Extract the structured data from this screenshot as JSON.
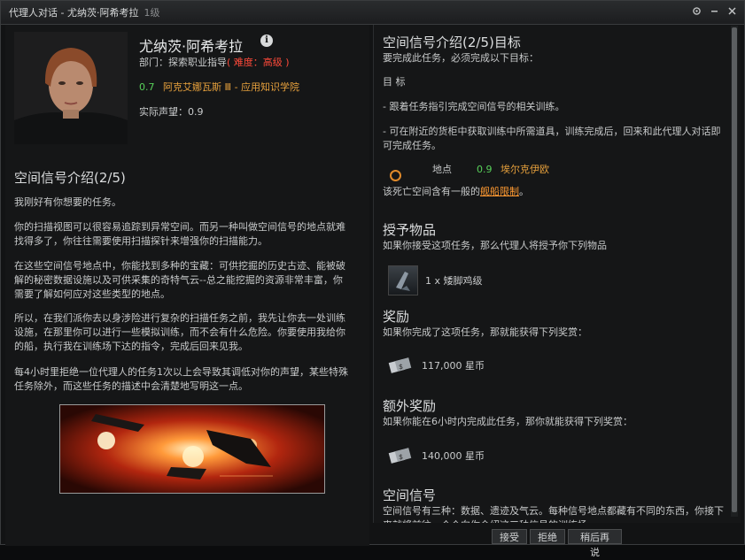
{
  "window": {
    "title": "代理人对话 - 尤纳茨·阿希考拉",
    "level": "1级",
    "buttons": [
      "gear-icon",
      "minimize-icon",
      "close-icon"
    ]
  },
  "agent": {
    "name": "尤纳茨·阿希考拉",
    "division_prefix": "部门：探索职业指导",
    "difficulty": "( 难度：高级 )",
    "security": "0.7",
    "location": "阿克艾娜瓦斯 Ⅲ - 应用知识学院",
    "standing": "实际声望：0.9"
  },
  "mission": {
    "title": "空间信号介绍(2/5)",
    "paragraphs": [
      "我刚好有你想要的任务。",
      "你的扫描视图可以很容易追踪到异常空间。而另一种叫做空间信号的地点就难找得多了，你往往需要使用扫描探针来增强你的扫描能力。",
      "在这些空间信号地点中，你能找到多种的宝藏：可供挖掘的历史古迹、能被破解的秘密数据设施以及可供采集的奇特气云--总之能挖掘的资源非常丰富，你需要了解如何应对这些类型的地点。",
      "所以，在我们派你去以身涉险进行复杂的扫描任务之前，我先让你去一处训练设施，在那里你可以进行一些模拟训练，而不会有什么危险。你要使用我给你的船，执行我在训练场下达的指令，完成后回来见我。",
      "每4小时里拒绝一位代理人的任务1次以上会导致其调低对你的声望，某些特殊任务除外，而这些任务的描述中会清楚地写明这一点。"
    ]
  },
  "objectives": {
    "title": "空间信号介绍(2/5)目标",
    "intro": "要完成此任务，必须完成以下目标：",
    "label": "目 标",
    "items": [
      "- 跟着任务指引完成空间信号的相关训练。",
      "- 可在附近的货柜中获取训练中所需道具，训练完成后，回来和此代理人对话即可完成任务。"
    ],
    "location_label": "地点",
    "location_security": "0.9",
    "location_name": "埃尔克伊欧",
    "restriction_prefix": "该死亡空间含有一般的",
    "restriction_link": "舰船限制",
    "restriction_suffix": "。"
  },
  "granted": {
    "title": "授予物品",
    "text": "如果你接受这项任务，那么代理人将授予你下列物品",
    "item": "1 x 矮脚鸡级"
  },
  "reward": {
    "title": "奖励",
    "text": "如果你完成了这项任务，那就能获得下列奖赏：",
    "amount": "117,000 星币"
  },
  "bonus": {
    "title": "额外奖励",
    "text": "如果你能在6小时内完成此任务，那你就能获得下列奖赏：",
    "amount": "140,000 星币"
  },
  "signatures": {
    "title": "空间信号",
    "text": "空间信号有三种：数据、遗迹及气云。每种信号地点都藏有不同的东西，你接下来就将前往一个个向你介绍这三种信号的训练场。"
  },
  "footer": {
    "accept": "接受",
    "decline": "拒绝",
    "later": "稍后再说"
  },
  "colors": {
    "difficulty": "#ff4a3a",
    "security_high": "#58d15a",
    "link_orange": "#e6a03c"
  }
}
